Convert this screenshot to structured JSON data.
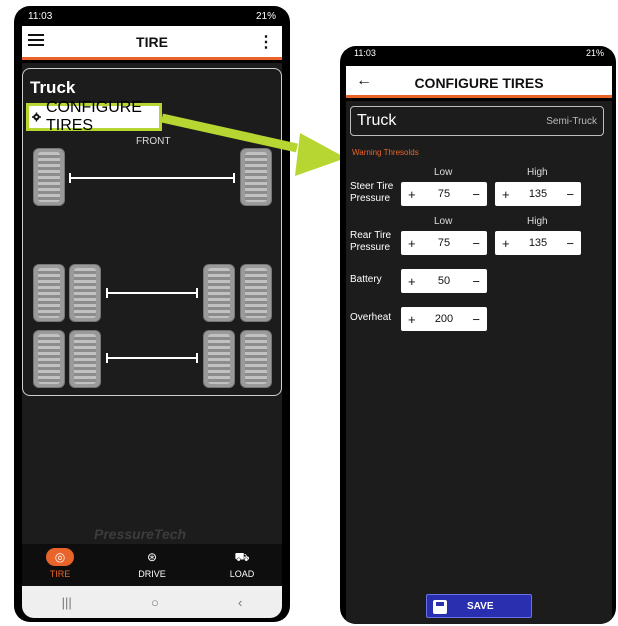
{
  "left_screen": {
    "status": {
      "time": "11:03",
      "battery": "21%"
    },
    "appbar": {
      "title": "TIRE"
    },
    "vehicle_name": "Truck",
    "configure_button": "CONFIGURE TIRES",
    "front_label": "FRONT",
    "brand": "PressureTech",
    "nav": [
      {
        "label": "TIRE",
        "icon": "tire-icon",
        "active": true
      },
      {
        "label": "DRIVE",
        "icon": "steering-wheel-icon",
        "active": false
      },
      {
        "label": "LOAD",
        "icon": "load-icon",
        "active": false
      }
    ],
    "system_nav": {
      "recents": "|||",
      "home": "○",
      "back": "‹"
    }
  },
  "right_screen": {
    "status": {
      "time": "11:03",
      "battery": "21%"
    },
    "appbar": {
      "title": "CONFIGURE TIRES",
      "back": "←"
    },
    "vehicle": {
      "name": "Truck",
      "type": "Semi-Truck"
    },
    "warning_label": "Warning Thresolds",
    "columns": {
      "low": "Low",
      "high": "High"
    },
    "rows": [
      {
        "label": "Steer Tire Pressure",
        "low": "75",
        "high": "135"
      },
      {
        "label": "Rear Tire Pressure",
        "low": "75",
        "high": "135"
      },
      {
        "label": "Battery",
        "low": "50"
      },
      {
        "label": "Overheat",
        "low": "200"
      }
    ],
    "stepper": {
      "plus": "+",
      "minus": "−"
    },
    "save_button": "SAVE"
  },
  "colors": {
    "accent": "#e8642a",
    "highlight": "#b7d632",
    "save": "#2a2fb0"
  }
}
